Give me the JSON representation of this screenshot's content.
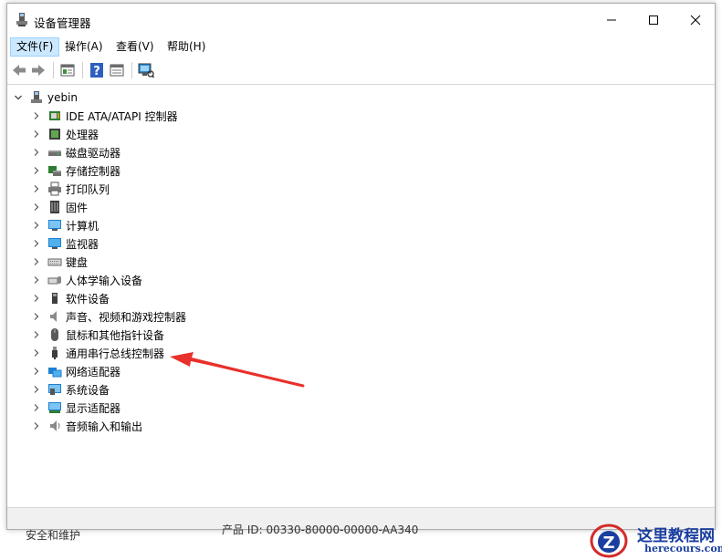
{
  "window": {
    "title": "设备管理器",
    "controls": {
      "minimize": "minimize-icon",
      "maximize": "maximize-icon",
      "close": "close-icon"
    }
  },
  "menu": [
    {
      "label": "文件(F)",
      "active": true
    },
    {
      "label": "操作(A)",
      "active": false
    },
    {
      "label": "查看(V)",
      "active": false
    },
    {
      "label": "帮助(H)",
      "active": false
    }
  ],
  "toolbar": [
    "back-icon",
    "forward-icon",
    "properties-icon",
    "help-icon",
    "device-view-icon",
    "scan-hardware-icon"
  ],
  "tree": {
    "root": {
      "label": "yebin",
      "expanded": true
    },
    "children": [
      {
        "label": "IDE ATA/ATAPI 控制器",
        "icon": "ide-controller-icon"
      },
      {
        "label": "处理器",
        "icon": "processor-icon"
      },
      {
        "label": "磁盘驱动器",
        "icon": "disk-drive-icon"
      },
      {
        "label": "存储控制器",
        "icon": "storage-controller-icon"
      },
      {
        "label": "打印队列",
        "icon": "printer-icon"
      },
      {
        "label": "固件",
        "icon": "firmware-icon"
      },
      {
        "label": "计算机",
        "icon": "computer-icon"
      },
      {
        "label": "监视器",
        "icon": "monitor-icon"
      },
      {
        "label": "键盘",
        "icon": "keyboard-icon"
      },
      {
        "label": "人体学输入设备",
        "icon": "hid-icon"
      },
      {
        "label": "软件设备",
        "icon": "software-device-icon"
      },
      {
        "label": "声音、视频和游戏控制器",
        "icon": "sound-icon"
      },
      {
        "label": "鼠标和其他指针设备",
        "icon": "mouse-icon"
      },
      {
        "label": "通用串行总线控制器",
        "icon": "usb-icon"
      },
      {
        "label": "网络适配器",
        "icon": "network-adapter-icon"
      },
      {
        "label": "系统设备",
        "icon": "system-device-icon"
      },
      {
        "label": "显示适配器",
        "icon": "display-adapter-icon"
      },
      {
        "label": "音频输入和输出",
        "icon": "audio-io-icon"
      }
    ]
  },
  "background": {
    "left_text": "安全和维护",
    "partial_text": "产品 ID: 00330-80000-00000-AA340"
  },
  "watermark": {
    "cn": "这里教程网",
    "en": "herecours.com"
  },
  "colors": {
    "menu_active_bg": "#cce8ff",
    "arrow": "#e8312a",
    "watermark": "#1a3fa0"
  }
}
